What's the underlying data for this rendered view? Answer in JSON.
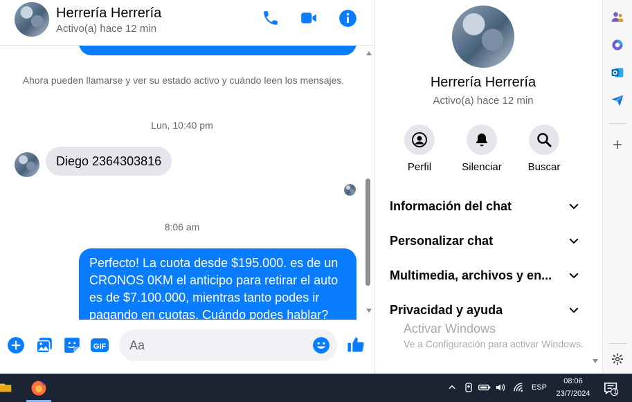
{
  "chat_header": {
    "name": "Herrería Herrería",
    "status": "Activo(a) hace 12 min"
  },
  "messages": {
    "system_notice": "Ahora pueden llamarse y ver su estado activo y cuándo leen los mensajes.",
    "time_1": "Lun, 10:40 pm",
    "incoming_text": "Diego 2364303816",
    "time_2": "8:06 am",
    "outgoing_text": "Perfecto! La cuota desde $195.000. es de un CRONOS 0KM el anticipo para retirar el auto es de $7.100.000, mientras tanto podes ir pagando en cuotas. Cuándo podes hablar?"
  },
  "composer": {
    "placeholder": "Aa"
  },
  "info": {
    "name": "Herrería Herrería",
    "status": "Activo(a) hace 12 min",
    "actions": [
      {
        "label": "Perfil"
      },
      {
        "label": "Silenciar"
      },
      {
        "label": "Buscar"
      }
    ],
    "sections": [
      {
        "label": "Información del chat"
      },
      {
        "label": "Personalizar chat"
      },
      {
        "label": "Multimedia, archivos y en..."
      },
      {
        "label": "Privacidad y ayuda"
      }
    ]
  },
  "watermark": {
    "line1": "Activar Windows",
    "line2": "Ve a Configuración para activar Windows."
  },
  "taskbar": {
    "lang": "ESP",
    "time": "08:06",
    "date": "23/7/2024",
    "notification_count": "1"
  },
  "colors": {
    "messenger_blue": "#0a7cff",
    "taskbar_bg": "#1c2333"
  }
}
